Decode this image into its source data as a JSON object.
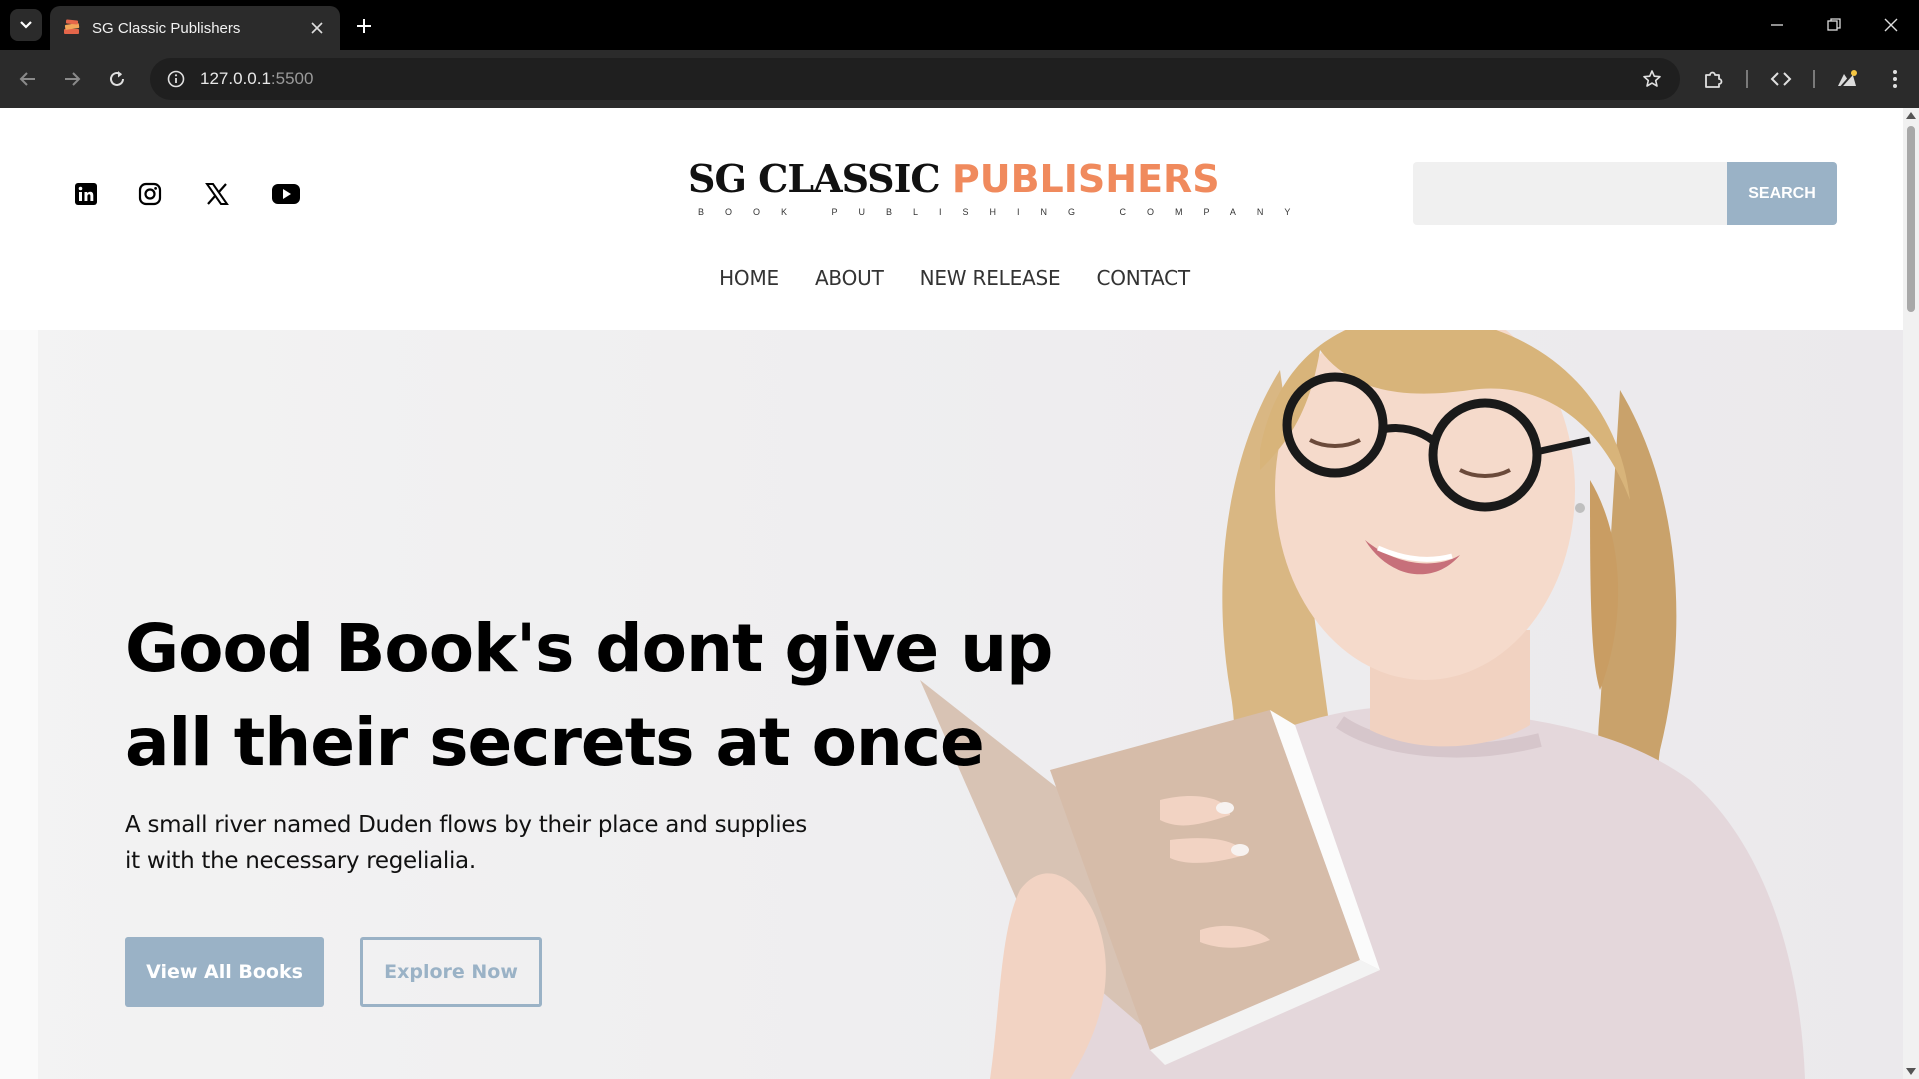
{
  "browser": {
    "tab_title": "SG Classic Publishers",
    "url_host": "127.0.0.1",
    "url_port": ":5500"
  },
  "header": {
    "social_icons": [
      "linkedin-icon",
      "instagram-icon",
      "x-icon",
      "youtube-icon"
    ],
    "logo_part1": "SG CLASSIC",
    "logo_part2": "PUBLISHERS",
    "tagline": "BOOK PUBLISHING COMPANY",
    "search_placeholder": "",
    "search_button": "SEARCH"
  },
  "nav": {
    "items": [
      {
        "label": "HOME"
      },
      {
        "label": "ABOUT"
      },
      {
        "label": "NEW RELEASE"
      },
      {
        "label": "CONTACT"
      }
    ]
  },
  "hero": {
    "title": "Good Book's dont give up all their secrets at once",
    "subtitle": "A small river named Duden flows by their place and supplies it with the necessary regelialia.",
    "primary_button": "View All Books",
    "secondary_button": "Explore Now"
  },
  "colors": {
    "accent": "#f08a5d",
    "button": "#9ab2c6"
  }
}
